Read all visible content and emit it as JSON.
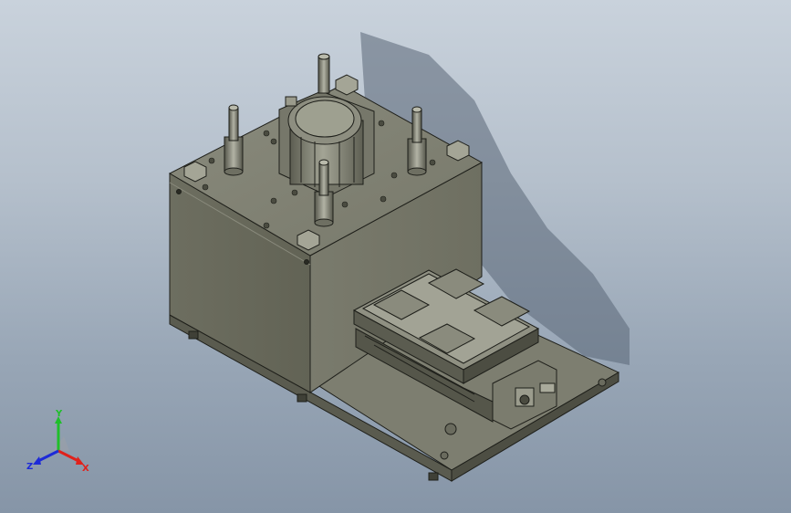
{
  "view": {
    "background_top": "#c9d2dc",
    "background_bottom": "#8695a7"
  },
  "model": {
    "body_color": "#6f7063",
    "plate_color": "#6b6c5e",
    "edge_color": "#1e1f1a"
  },
  "triad": {
    "x_label": "X",
    "y_label": "Y",
    "z_label": "Z",
    "x_color": "#e0211b",
    "y_color": "#1fbf2a",
    "z_color": "#1d2ad8"
  }
}
